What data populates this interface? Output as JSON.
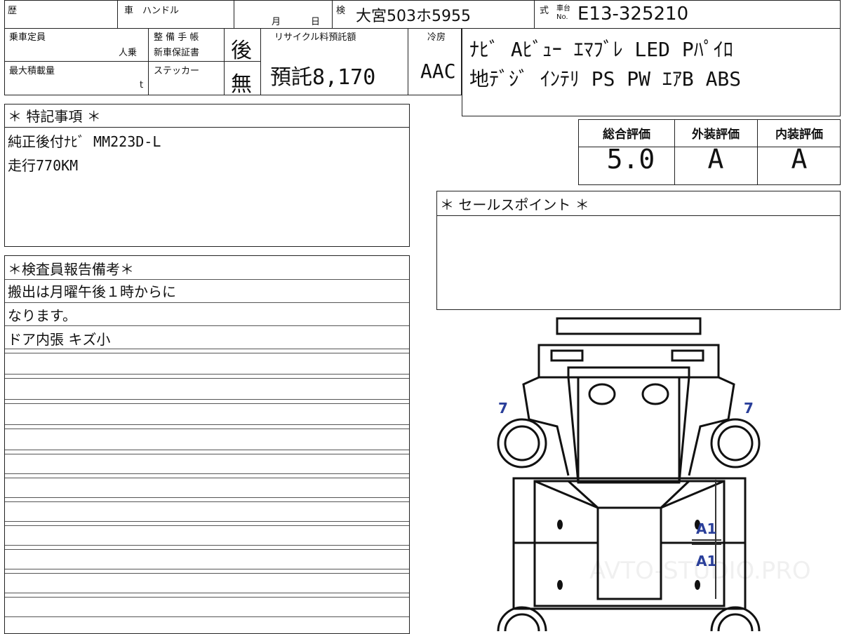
{
  "header": {
    "history_label": "歴",
    "car_label": "車",
    "handle_label": "ハンドル",
    "month_label": "月",
    "day_label": "日",
    "inspection_label": "検",
    "plate": "大宮503ホ5955",
    "model_label": "式",
    "chassis_label_top": "車台",
    "chassis_label_no": "No.",
    "chassis_no": "E13-325210"
  },
  "row2": {
    "capacity_label": "乗車定員",
    "capacity_unit": "人乗",
    "maintenance_label": "整 備 手 帳",
    "warranty_label": "新車保証書",
    "maintenance_value": "後",
    "recycle_label": "リサイクル料預託額",
    "recycle_value": "預託8,170",
    "ac_label": "冷房",
    "ac_value": "AAC",
    "max_load_label": "最大積載量",
    "max_load_unit": "t",
    "sticker_label": "ステッカー",
    "sticker_value": "無"
  },
  "equipment": {
    "line1": "ﾅﾋﾞ Aﾋﾞｭｰ ｴﾏﾌﾞﾚ LED Pﾊﾟｲﾛ",
    "line2": "地ﾃﾞｼﾞ ｲﾝﾃﾘ PS PW ｴｱB ABS"
  },
  "special_notes": {
    "title": "＊ 特記事項 ＊",
    "lines": [
      "純正後付ﾅﾋﾞ MM223D-L",
      "走行770KM"
    ]
  },
  "ratings": {
    "overall_label": "総合評価",
    "exterior_label": "外装評価",
    "interior_label": "内装評価",
    "overall": "5.0",
    "exterior": "A",
    "interior": "A"
  },
  "sales_point": {
    "title": "＊ セールスポイント ＊"
  },
  "inspector": {
    "title": "＊検査員報告備考＊",
    "lines": [
      "搬出は月曜午後１時からに",
      "なります。",
      "ドア内張 キズ小"
    ]
  },
  "diagram": {
    "marks": {
      "tire_fl": "7",
      "tire_fr": "7",
      "door_front": "A1",
      "door_rear": "A1"
    },
    "watermark": "AVTO-STUDIO.PRO"
  },
  "colors": {
    "line": "#222222",
    "mark": "#2a3f9a"
  }
}
